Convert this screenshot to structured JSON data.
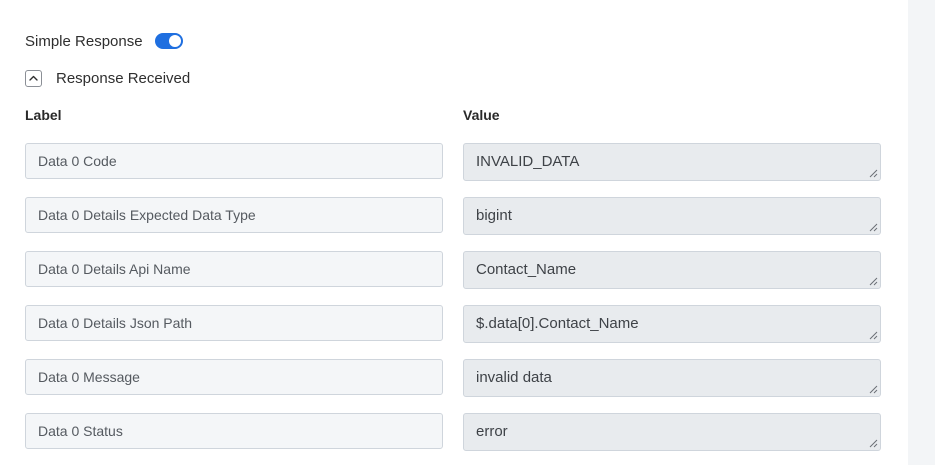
{
  "simple_response": {
    "label": "Simple Response",
    "enabled": true
  },
  "response_section": {
    "label": "Response Received",
    "expanded": true
  },
  "columns": {
    "label": "Label",
    "value": "Value"
  },
  "rows": [
    {
      "label": "Data 0 Code",
      "value": "INVALID_DATA"
    },
    {
      "label": "Data 0 Details Expected Data Type",
      "value": "bigint"
    },
    {
      "label": "Data 0 Details Api Name",
      "value": "Contact_Name"
    },
    {
      "label": "Data 0 Details Json Path",
      "value": "$.data[0].Contact_Name"
    },
    {
      "label": "Data 0 Message",
      "value": "invalid data"
    },
    {
      "label": "Data 0 Status",
      "value": "error"
    }
  ],
  "colors": {
    "accent": "#1f6fe0"
  }
}
